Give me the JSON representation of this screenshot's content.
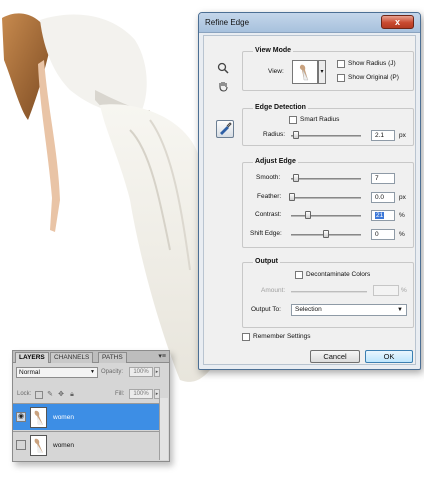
{
  "dialog": {
    "title": "Refine Edge",
    "close_glyph": "x",
    "view_mode": {
      "heading": "View Mode",
      "view_label": "View:",
      "show_radius_label": "Show Radius (J)",
      "show_original_label": "Show Original (P)",
      "show_radius_checked": false,
      "show_original_checked": false
    },
    "edge_detection": {
      "heading": "Edge Detection",
      "smart_radius_label": "Smart Radius",
      "smart_radius_checked": false,
      "radius_label": "Radius:",
      "radius_value": "2.1",
      "radius_unit": "px",
      "radius_level": 0.05
    },
    "adjust_edge": {
      "heading": "Adjust Edge",
      "smooth_label": "Smooth:",
      "smooth_value": "7",
      "smooth_level": 0.07,
      "feather_label": "Feather:",
      "feather_value": "0.0",
      "feather_unit": "px",
      "feather_level": 0.0,
      "contrast_label": "Contrast:",
      "contrast_value": "21",
      "contrast_unit": "%",
      "contrast_level": 0.21,
      "shift_edge_label": "Shift Edge:",
      "shift_edge_value": "0",
      "shift_edge_unit": "%",
      "shift_edge_level": 0.5
    },
    "output": {
      "heading": "Output",
      "decontaminate_label": "Decontaminate Colors",
      "decontaminate_checked": false,
      "amount_label": "Amount:",
      "amount_unit": "%",
      "output_to_label": "Output To:",
      "output_to_value": "Selection"
    },
    "remember_label": "Remember Settings",
    "remember_checked": false,
    "cancel_label": "Cancel",
    "ok_label": "OK"
  },
  "layers_panel": {
    "tabs": [
      "LAYERS",
      "CHANNELS",
      "PATHS"
    ],
    "active_tab": "LAYERS",
    "menu_glyph": "▾≡",
    "blend_mode": "Normal",
    "opacity_label": "Opacity:",
    "opacity_value": "100%",
    "lock_label": "Lock:",
    "fill_label": "Fill:",
    "fill_value": "100%",
    "layers": [
      {
        "name": "women",
        "selected": true,
        "visible": true
      },
      {
        "name": "women",
        "selected": false,
        "visible": false
      }
    ]
  },
  "icons": [
    "zoom-icon",
    "hand-icon",
    "refine-radius-brush-icon",
    "close-icon",
    "eye-icon",
    "lock-icons"
  ],
  "colors": {
    "selection_blue": "#3d8ee5",
    "close_red": "#c94a30",
    "title_bar": "#b4cbe3"
  }
}
